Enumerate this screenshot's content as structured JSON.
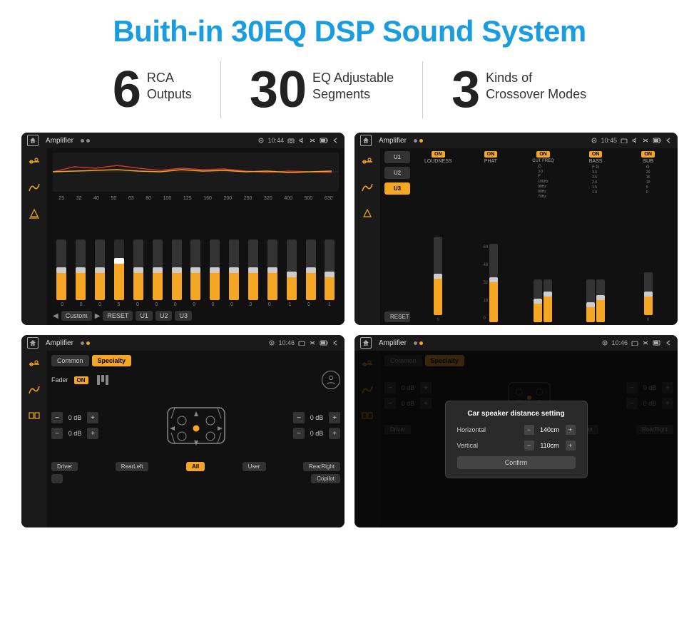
{
  "page": {
    "title": "Buith-in 30EQ DSP Sound System",
    "background": "#ffffff"
  },
  "stats": [
    {
      "number": "6",
      "label": "RCA\nOutputs"
    },
    {
      "number": "30",
      "label": "EQ Adjustable\nSegments"
    },
    {
      "number": "3",
      "label": "Kinds of\nCrossover Modes"
    }
  ],
  "screens": [
    {
      "id": "eq-screen",
      "status_title": "Amplifier",
      "time": "10:44",
      "type": "eq"
    },
    {
      "id": "amp-screen",
      "status_title": "Amplifier",
      "time": "10:45",
      "type": "amp"
    },
    {
      "id": "fader-screen",
      "status_title": "Amplifier",
      "time": "10:46",
      "type": "fader"
    },
    {
      "id": "dialog-screen",
      "status_title": "Amplifier",
      "time": "10:46",
      "type": "dialog"
    }
  ],
  "eq": {
    "frequencies": [
      "25",
      "32",
      "40",
      "50",
      "63",
      "80",
      "100",
      "125",
      "160",
      "200",
      "250",
      "320",
      "400",
      "500",
      "630"
    ],
    "values": [
      "0",
      "0",
      "0",
      "5",
      "0",
      "0",
      "0",
      "0",
      "0",
      "0",
      "0",
      "0",
      "-1",
      "0",
      "-1"
    ],
    "mode": "Custom",
    "buttons": [
      "U1",
      "U2",
      "U3"
    ]
  },
  "amp": {
    "presets": [
      "U1",
      "U2",
      "U3"
    ],
    "channels": [
      {
        "label": "LOUDNESS",
        "on": true
      },
      {
        "label": "PHAT",
        "on": true
      },
      {
        "label": "CUT FREQ",
        "on": true
      },
      {
        "label": "BASS",
        "on": true
      },
      {
        "label": "SUB",
        "on": true
      }
    ],
    "reset_label": "RESET"
  },
  "fader": {
    "tabs": [
      "Common",
      "Specialty"
    ],
    "fader_label": "Fader",
    "on_label": "ON",
    "db_values": [
      "0 dB",
      "0 dB",
      "0 dB",
      "0 dB"
    ],
    "buttons": {
      "driver": "Driver",
      "rear_left": "RearLeft",
      "all": "All",
      "user": "User",
      "rear_right": "RearRight",
      "copilot": "Copilot"
    }
  },
  "dialog": {
    "title": "Car speaker distance setting",
    "horizontal_label": "Horizontal",
    "horizontal_value": "140cm",
    "vertical_label": "Vertical",
    "vertical_value": "110cm",
    "confirm_label": "Confirm"
  }
}
